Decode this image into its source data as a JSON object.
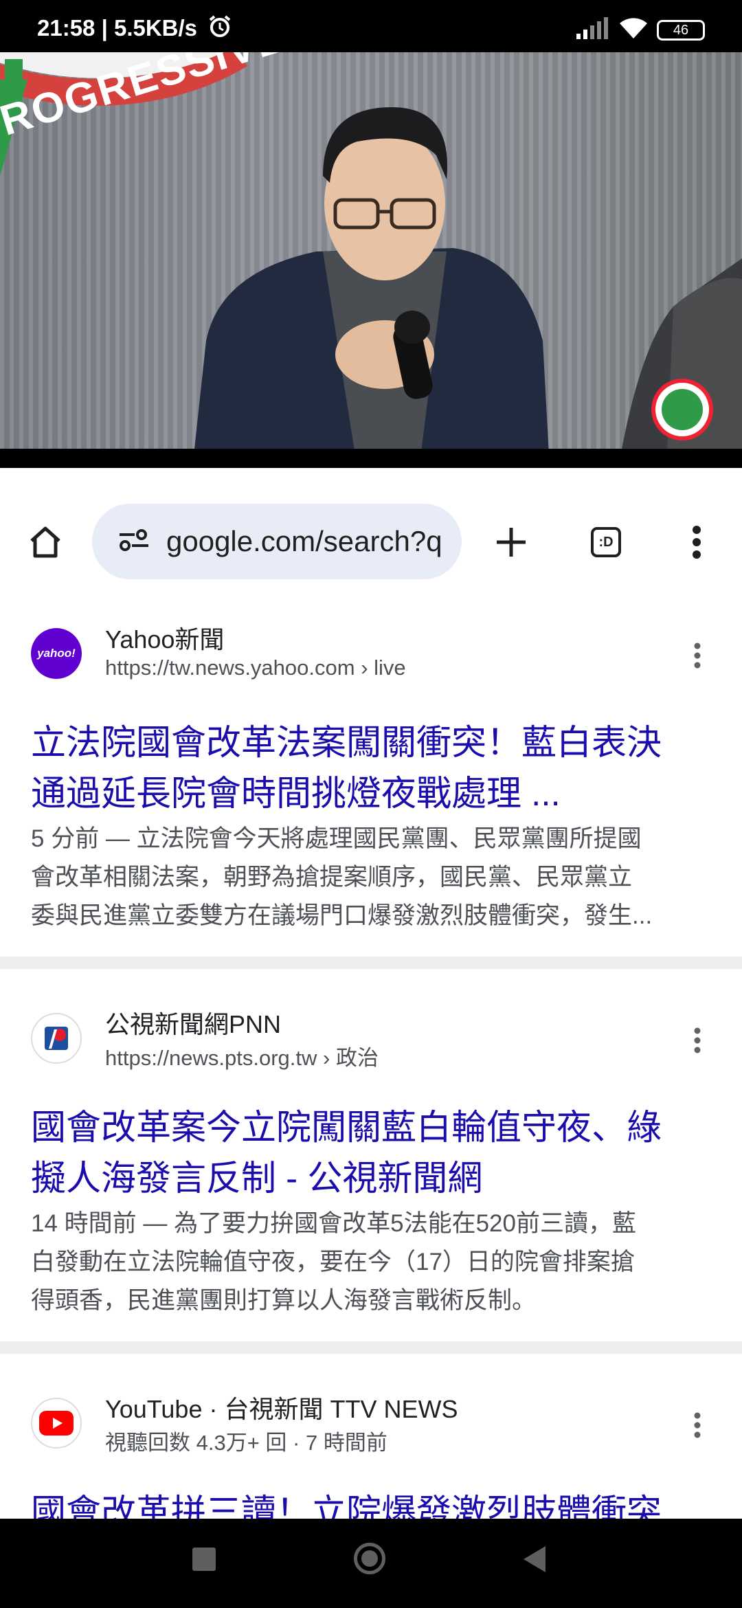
{
  "status_bar": {
    "time_speed": "21:58 | 5.5KB/s",
    "battery": "46"
  },
  "video": {
    "background_sign_text": "ROGRESSIVE"
  },
  "toolbar": {
    "url": "google.com/search?q",
    "tab_switcher_label": ":D"
  },
  "results": [
    {
      "site_name": "Yahoo新聞",
      "favicon_text": "yahoo!",
      "url": "https://tw.news.yahoo.com",
      "url_path": " › live",
      "title_line1": "立法院國會改革法案闖關衝突！藍白表決",
      "title_line2": "通過延長院會時間挑燈夜戰處理 ...",
      "snippet_line1": "5 分前 — 立法院會今天將處理國民黨團、民眾黨團所提國",
      "snippet_line2": "會改革相關法案，朝野為搶提案順序，國民黨、民眾黨立",
      "snippet_line3": "委與民進黨立委雙方在議場門口爆發激烈肢體衝突，發生..."
    },
    {
      "site_name": "公視新聞網PNN",
      "url": "https://news.pts.org.tw",
      "url_path": " › 政治",
      "title_line1": "國會改革案今立院闖關藍白輪值守夜、綠",
      "title_line2": "擬人海發言反制 - 公視新聞網",
      "snippet_line1": "14 時間前 — 為了要力拚國會改革5法能在520前三讀，藍",
      "snippet_line2": "白發動在立法院輪值守夜，要在今（17）日的院會排案搶",
      "snippet_line3": "得頭香，民進黨團則打算以人海發言戰術反制。"
    },
    {
      "site_name": "YouTube · 台視新聞 TTV NEWS",
      "url": "視聽回数 4.3万+ 回 · 7 時間前",
      "title_line1": "國會改革拼三讀！立院爆發激烈肢體衝突"
    }
  ],
  "colors": {
    "link": "#1a0dab",
    "snippet": "#4d5156",
    "omnibox_bg": "#e8ecf7",
    "yahoo_purple": "#6001d2",
    "youtube_red": "#ff0000"
  }
}
